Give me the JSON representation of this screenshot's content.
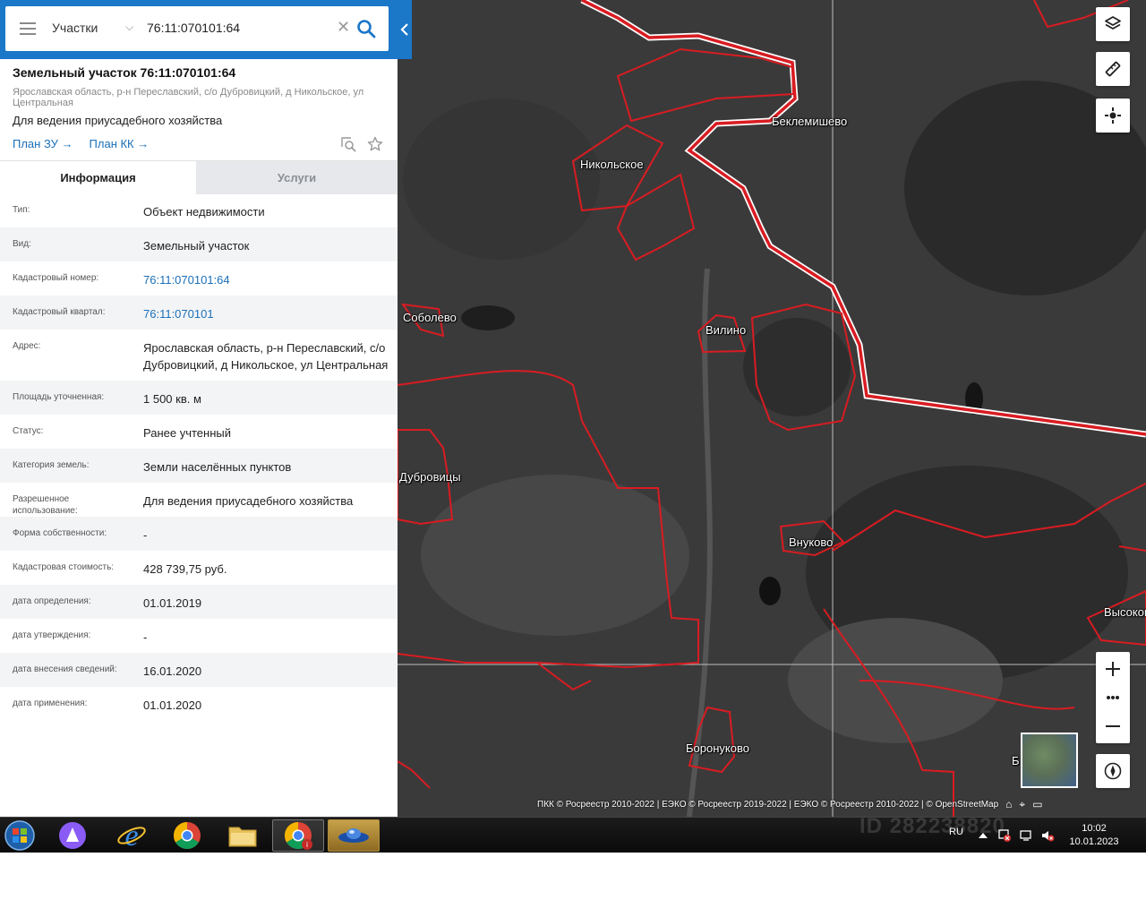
{
  "search": {
    "category": "Участки",
    "query": "76:11:070101:64"
  },
  "object": {
    "title": "Земельный участок 76:11:070101:64",
    "address": "Ярославская область, р-н Переславский, с/о Дубровицкий, д Никольское, ул Центральная",
    "purpose": "Для ведения приусадебного хозяйства",
    "links": [
      {
        "label": "План ЗУ →"
      },
      {
        "label": "План КК →"
      }
    ]
  },
  "tabs": [
    {
      "label": "Информация"
    },
    {
      "label": "Услуги"
    }
  ],
  "info": [
    {
      "key": "Тип:",
      "value": "Объект недвижимости"
    },
    {
      "key": "Вид:",
      "value": "Земельный участок"
    },
    {
      "key": "Кадастровый номер:",
      "value": "76:11:070101:64"
    },
    {
      "key": "Кадастровый квартал:",
      "value": "76:11:070101"
    },
    {
      "key": "Адрес:",
      "value": "Ярославская область, р-н Переславский, с/о Дубровицкий, д Никольское, ул Центральная"
    },
    {
      "key": "Площадь уточненная:",
      "value": "1 500 кв. м"
    },
    {
      "key": "Статус:",
      "value": "Ранее учтенный"
    },
    {
      "key": "Категория земель:",
      "value": "Земли населённых пунктов"
    },
    {
      "key": "Разрешенное использование:",
      "value": "Для ведения приусадебного хозяйства"
    },
    {
      "key": "Форма собственности:",
      "value": "-"
    },
    {
      "key": "Кадастровая стоимость:",
      "value": "428 739,75 руб."
    },
    {
      "key": "дата определения:",
      "value": "01.01.2019"
    },
    {
      "key": "дата утверждения:",
      "value": "-"
    },
    {
      "key": "дата внесения сведений:",
      "value": "16.01.2020"
    },
    {
      "key": "дата применения:",
      "value": "01.01.2020"
    }
  ],
  "map": {
    "labels": [
      "Беклемишево",
      "Никольское",
      "Соболево",
      "Вилино",
      "Дубровицы",
      "Внуково",
      "Высоково",
      "Боронуково",
      "Б"
    ],
    "attribution": "ПКК © Росреестр 2010-2022 | ЕЭКО © Росреестр 2019-2022 | ЕЭКО © Росреестр 2010-2022 | © OpenStreetMap",
    "boundary_color": "#d81c22"
  },
  "taskbar": {
    "lang": "RU",
    "time": "10:02",
    "date": "10.01.2023"
  },
  "watermark": "ID 282238820",
  "colors": {
    "brand": "#1b77c8",
    "link": "#1b6fb8"
  }
}
